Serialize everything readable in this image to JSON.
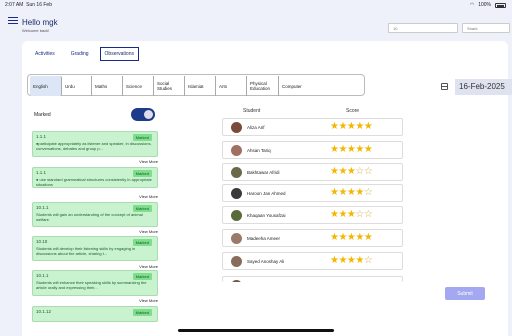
{
  "status": {
    "time": "2:07 AM",
    "date": "Sun 16 Feb",
    "battery": "100%"
  },
  "header": {
    "greeting": "Hello mgk",
    "sub": "Welcome back!",
    "select1": "10",
    "select2": "Shark"
  },
  "tabs": [
    {
      "label": "Activities"
    },
    {
      "label": "Grading"
    },
    {
      "label": "Observations"
    }
  ],
  "subjects": [
    "English",
    "Urdu",
    "Maths",
    "Science",
    "Social Studies",
    "Islamiat",
    "Arts",
    "Physical Education",
    "Computer"
  ],
  "date": "16-Feb-2025",
  "toggle_label": "Marked",
  "observations": [
    {
      "code": "1.1.1",
      "badge": "Marked",
      "text": "●participate appropriately as listener and speaker, in discussions, conversations, debates and group p...",
      "more": "View More"
    },
    {
      "code": "1.1.1",
      "badge": "Marked",
      "text": "● use standard grammatical structures consistently in appropriate situations",
      "more": "View More"
    },
    {
      "code": "10.1.1",
      "badge": "Marked",
      "text": "Students will gain an understanding of the concept of animal welfare.",
      "more": "View More"
    },
    {
      "code": "10.10",
      "badge": "Marked",
      "text": "Students will develop their listening skills by engaging in discussions about the article, sharing t...",
      "more": "View More"
    },
    {
      "code": "10.1.1",
      "badge": "Marked",
      "text": "Students will enhance their speaking skills by summarizing the article orally and expressing their...",
      "more": "View More"
    },
    {
      "code": "10.1.12",
      "badge": "Marked",
      "text": "",
      "more": ""
    }
  ],
  "students_header": {
    "student": "Student",
    "score": "Score"
  },
  "students": [
    {
      "name": "Aliza Arif",
      "stars": "★★★★★",
      "off": ""
    },
    {
      "name": "Ahsan Tariq",
      "stars": "★★★★★",
      "off": ""
    },
    {
      "name": "Bakhtawar Afridi",
      "stars": "★★★",
      "off": "☆☆"
    },
    {
      "name": "Haroon Jan Ahmed",
      "stars": "★★★★",
      "off": "☆"
    },
    {
      "name": "Khaqaan Yousafzai",
      "stars": "★★★",
      "off": "☆☆"
    },
    {
      "name": "Madeeha Ameer",
      "stars": "★★★★★",
      "off": ""
    },
    {
      "name": "Sayed Anoshay Ali",
      "stars": "★★★★",
      "off": "☆"
    }
  ],
  "submit_label": "Submit",
  "colors": {
    "accent": "#1e3a8a",
    "marked_bg": "#c9f2cf",
    "star": "#f2b705",
    "submit": "#a3a8f0"
  }
}
